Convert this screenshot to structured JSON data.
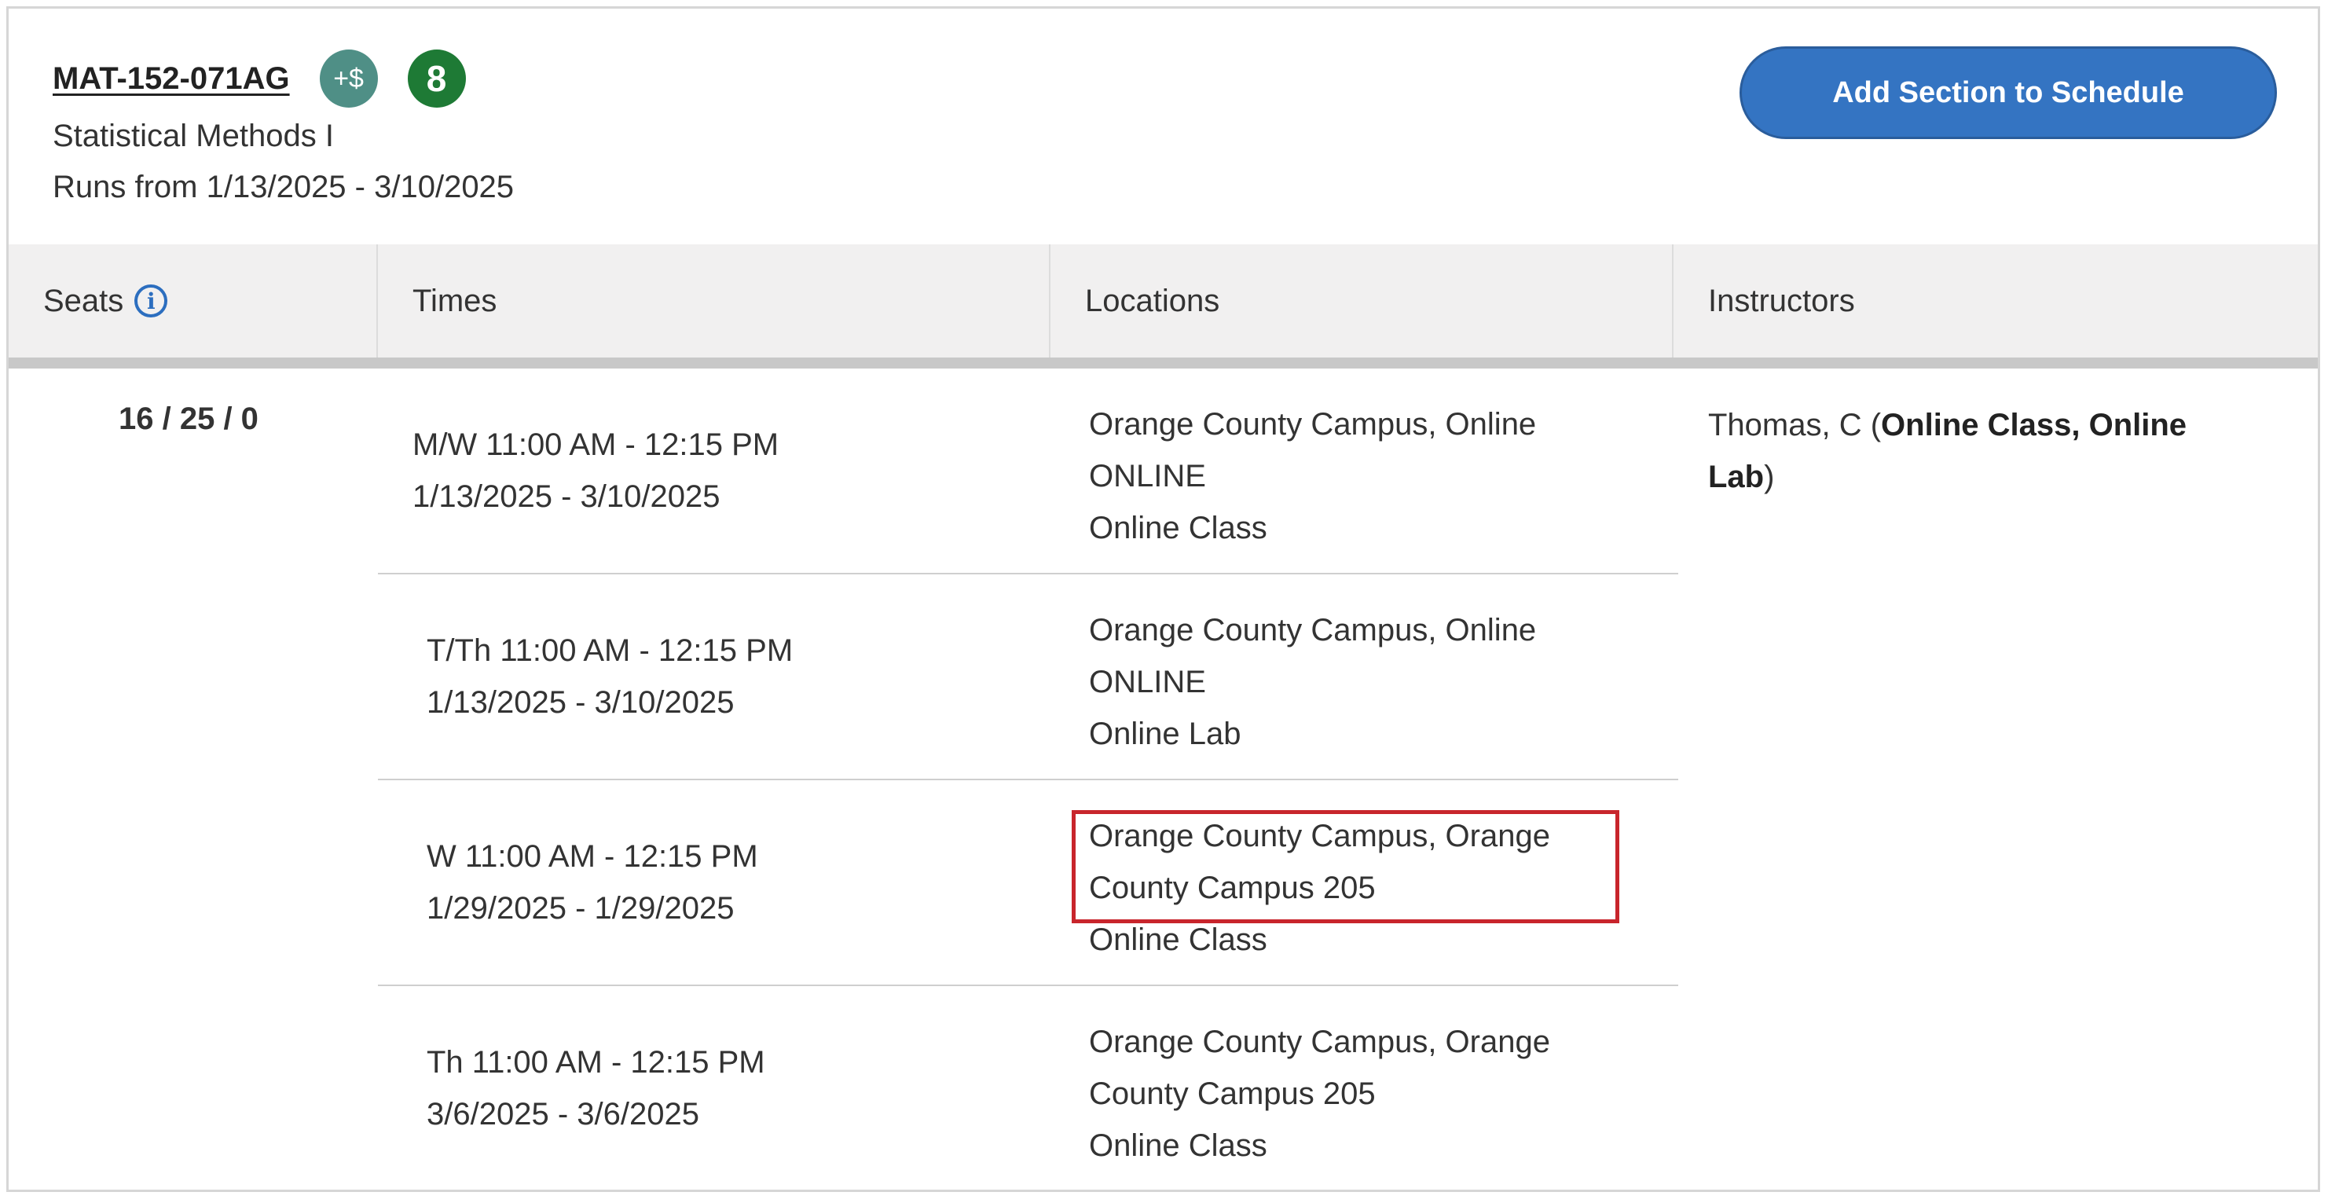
{
  "header": {
    "course_code": "MAT-152-071AG",
    "cost_badge": "+$",
    "count_badge": "8",
    "title": "Statistical Methods I",
    "runs": "Runs from 1/13/2025 - 3/10/2025",
    "add_button": "Add Section to Schedule"
  },
  "table": {
    "headers": {
      "seats": "Seats",
      "times": "Times",
      "locations": "Locations",
      "instructors": "Instructors"
    },
    "seats_value": "16 / 25 / 0",
    "meetings": [
      {
        "days_time": "M/W 11:00 AM - 12:15 PM",
        "dates": "1/13/2025 - 3/10/2025",
        "location_lines": [
          "Orange County Campus, Online",
          "ONLINE",
          "Online Class"
        ]
      },
      {
        "days_time": "T/Th 11:00 AM - 12:15 PM",
        "dates": "1/13/2025 - 3/10/2025",
        "location_lines": [
          "Orange County Campus, Online",
          "ONLINE",
          "Online Lab"
        ]
      },
      {
        "days_time": "W 11:00 AM - 12:15 PM",
        "dates": "1/29/2025 - 1/29/2025",
        "location_lines": [
          "Orange County Campus, Orange",
          "County Campus 205",
          "Online Class"
        ]
      },
      {
        "days_time": "Th 11:00 AM - 12:15 PM",
        "dates": "3/6/2025 - 3/6/2025",
        "location_lines": [
          "Orange County Campus, Orange",
          "County Campus 205",
          "Online Class"
        ]
      }
    ],
    "instructor": {
      "name": "Thomas, C (",
      "roles_line1": "Online Class, Online",
      "roles_line2": "Lab",
      "close_paren": ")"
    }
  },
  "colors": {
    "primary_button": "#3474c2",
    "cost_badge": "#4f8f86",
    "count_badge": "#1e7a35",
    "highlight_border": "#c8252c",
    "header_bg": "#f1f0f0"
  },
  "icons": {
    "seats_info": "info-circle-icon"
  }
}
